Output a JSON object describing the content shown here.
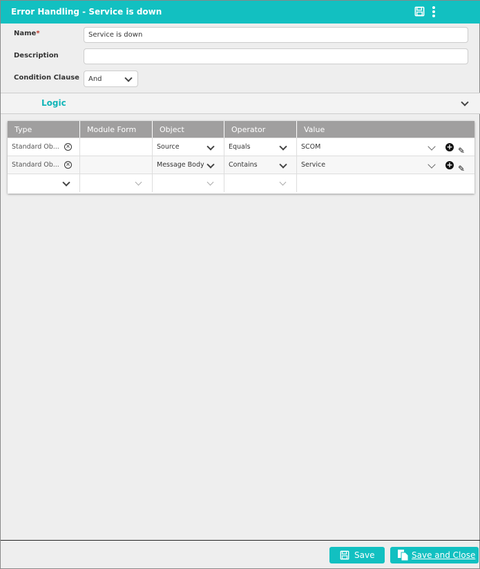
{
  "header": {
    "title": "Error Handling - Service is down",
    "icons": [
      "save-icon",
      "more-vertical-icon"
    ]
  },
  "form": {
    "name_label": "Name",
    "required_mark": "*",
    "name_value": "Service is down",
    "description_label": "Description",
    "description_value": "",
    "condition_label": "Condition Clause",
    "condition_value": "And"
  },
  "logic": {
    "title": "Logic"
  },
  "table": {
    "columns": [
      "Type",
      "Module Form",
      "Object",
      "Operator",
      "Value"
    ],
    "rows": [
      {
        "type": "Standard Ob...",
        "module_form": "",
        "object": "Source",
        "operator": "Equals",
        "value": "SCOM"
      },
      {
        "type": "Standard Ob...",
        "module_form": "",
        "object": "Message Body",
        "operator": "Contains",
        "value": "Service"
      }
    ]
  },
  "footer": {
    "save": "Save",
    "save_close": "Save and Close"
  },
  "colors": {
    "accent": "#12c0c1",
    "table_header": "#a09f9f"
  }
}
